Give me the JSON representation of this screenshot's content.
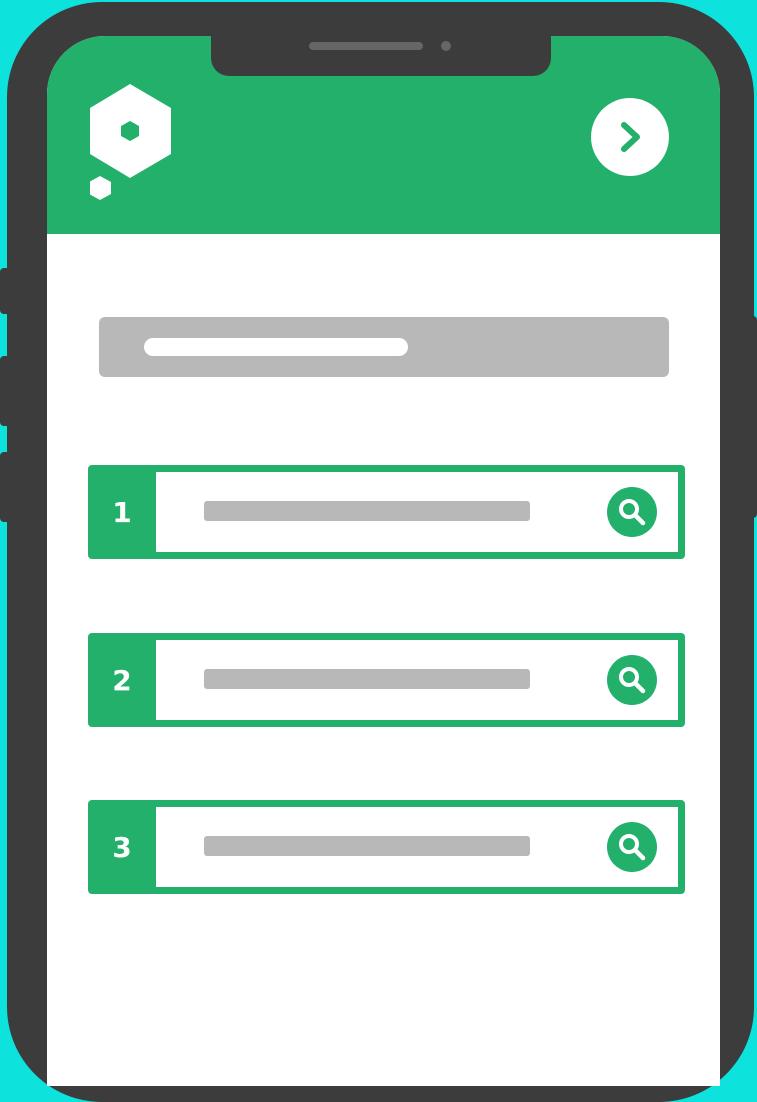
{
  "colors": {
    "background": "#0de3dc",
    "accent": "#22b06b",
    "frame": "#3c3c3c",
    "placeholder": "#b8b8b8"
  },
  "header": {
    "logo_icon": "hexagon-logo-icon",
    "next_icon": "chevron-right-icon"
  },
  "main": {
    "title_placeholder": "text-placeholder-bar",
    "rows": [
      {
        "number": "1",
        "icon": "search-icon"
      },
      {
        "number": "2",
        "icon": "search-icon"
      },
      {
        "number": "3",
        "icon": "search-icon"
      }
    ]
  }
}
